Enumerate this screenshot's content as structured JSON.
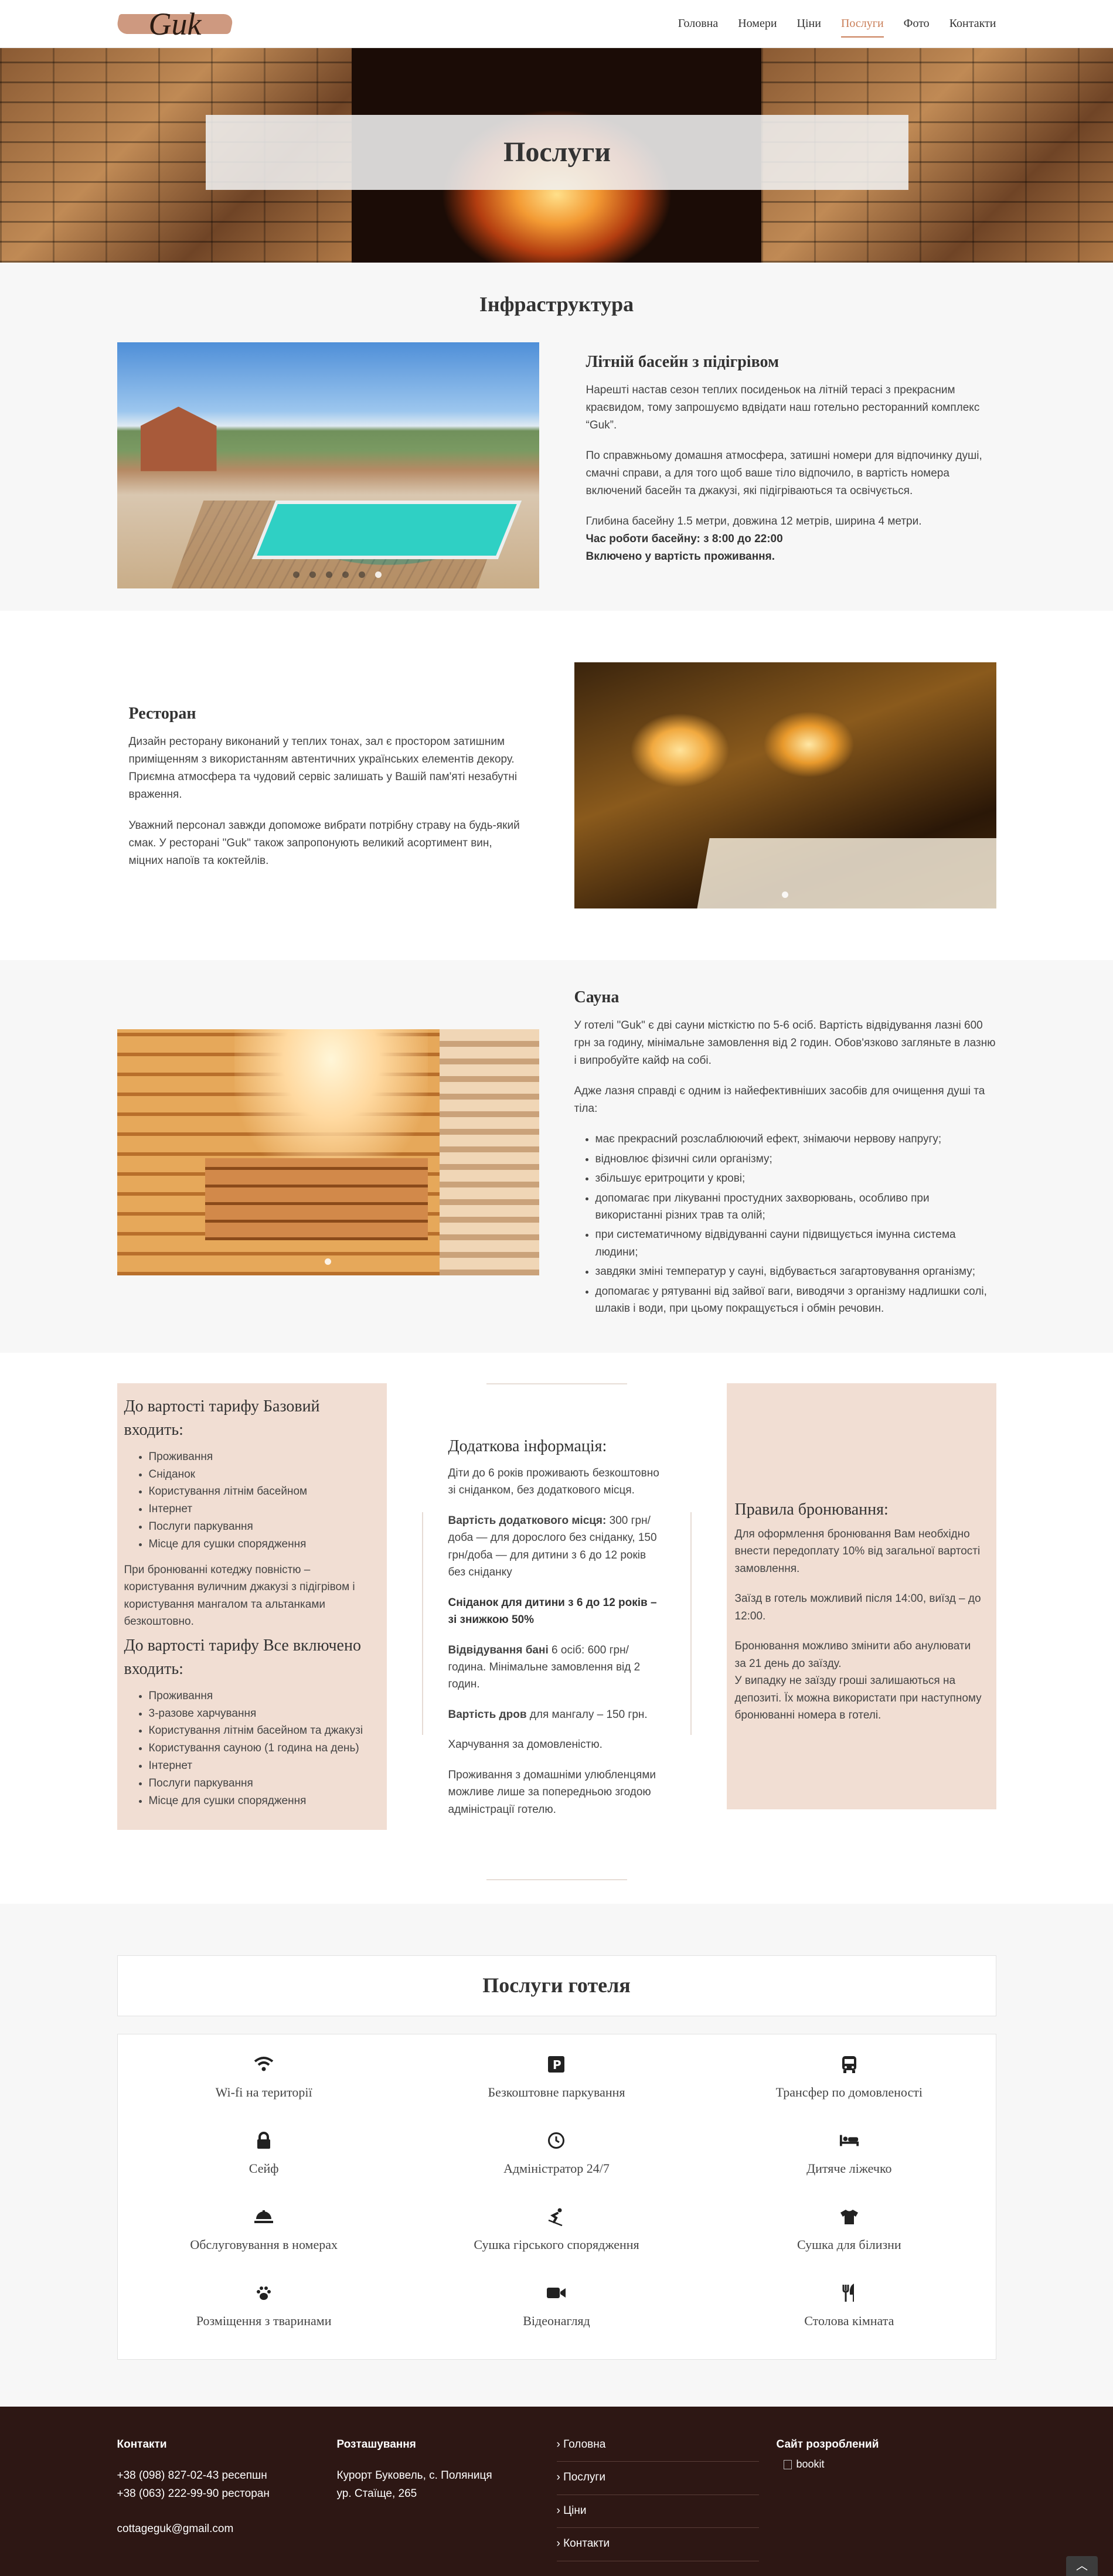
{
  "header": {
    "logo_text": "Guk",
    "nav": [
      {
        "label": "Головна"
      },
      {
        "label": "Номери"
      },
      {
        "label": "Ціни"
      },
      {
        "label": "Послуги",
        "active": true
      },
      {
        "label": "Фото"
      },
      {
        "label": "Контакти"
      }
    ],
    "accent_color": "#c97d57"
  },
  "hero": {
    "title": "Послуги"
  },
  "infrastructure": {
    "title": "Інфраструктура",
    "pool": {
      "title": "Літній басейн з підігрівом",
      "p1": "Нарешті настав сезон теплих посиденьок на літній терасі з прекрасним краєвидом, тому запрошуємо вдвідати наш готельно ресторанний комплекс “Guk”.",
      "p2": "По справжньому домашня атмосфера, затишні номери для відпочинку душі, смачні справи, а для того щоб ваше тіло відпочило, в вартість номера включений басейн та джакузі, які підігріваються та освічується.",
      "p3": "Глибина басейну 1.5 метри, довжина 12 метрів, ширина 4 метри.",
      "hours": "Час роботи басейну: з 8:00 до 22:00",
      "included": "Включено у вартість проживання.",
      "slides": 6
    },
    "restaurant": {
      "title": "Ресторан",
      "p1": "Дизайн ресторану виконаний у теплих тонах, зал є простором затишним приміщенням з використанням автентичних українських елементів декору.",
      "p2": "Приємна атмосфера та чудовий сервіс залишать у Вашій пам'яті незабутні враження.",
      "p3": "Уважний персонал завжди допоможе вибрати потрібну страву на будь-який смак. У ресторані \"Guk\" також запропонують великий асортимент вин, міцних напоїв та коктейлів.",
      "slides": 1
    },
    "sauna": {
      "title": "Сауна",
      "p1": "У готелі \"Guk\" є дві сауни місткістю по 5-6 осіб. Вартість відвідування лазні 600 грн за годину, мінімальне замовлення від 2 годин. Обов'язково загляньте в лазню і випробуйте кайф на собі.",
      "p2": "Адже лазня справді є одним із найефективніших засобів для очищення душі та тіла:",
      "benefits": [
        "має прекрасний розслаблюючий ефект, знімаючи нервову напругу;",
        "відновлює фізичні сили організму;",
        "збільшує еритроцити у крові;",
        "допомагає при лікуванні простудних захворювань, особливо при використанні різних трав та олій;",
        "при систематичному відвідуванні сауни підвищується імунна система людини;",
        "завдяки зміні температур у сауні, відбувається загартовування організму;",
        "допомагає у рятуванні від зайвої ваги, виводячи з організму надлишки солі, шлаків і води, при цьому покращується і обмін речовин."
      ],
      "slides": 1
    }
  },
  "tariffs": {
    "base": {
      "title": "До вартості тарифу Базовий входить:",
      "items": [
        "Проживання",
        "Сніданок",
        "Користування літнім басейном",
        "Інтернет",
        "Послуги паркування",
        "Місце для сушки спорядження"
      ],
      "note": "При бронюванні котеджу повністю – користування вуличним джакузі з підігрівом і користування мангалом та альтанками безкоштовно."
    },
    "all_inclusive": {
      "title": "До вартості тарифу Все включено входить:",
      "items": [
        "Проживання",
        "3-разове харчування",
        "Користування літнім басейном та джакузі",
        "Користування сауною (1 година на день)",
        "Інтернет",
        "Послуги паркування",
        "Місце для сушки спорядження"
      ]
    },
    "extra": {
      "title": "Додаткова інформація:",
      "p1": "Діти до 6 років проживають безкоштовно зі сніданком, без додаткового місця.",
      "extra_bed_label": "Вартість додаткового місця:",
      "extra_bed_text": " 300 грн/доба — для дорослого без сніданку, 150 грн/доба — для дитини з 6 до 12 років без сніданку",
      "kids_breakfast": "Сніданок для дитини з 6 до 12 років – зі знижкою 50%",
      "bath_label": "Відвідування бані",
      "bath_text": " 6 осіб: 600 грн/година. Мінімальне замовлення від 2 годин.",
      "wood_label": "Вартість дров",
      "wood_text": " для мангалу – 150 грн.",
      "meals": "Харчування за домовленістю.",
      "pets": "Проживання з домашніми улюбленцями можливе лише за попередньою згодою адміністрації готелю."
    },
    "rules": {
      "title": "Правила бронювання:",
      "p1": "Для оформлення бронювання Вам необхідно внести передоплату 10% від загальної вартості замовлення.",
      "p2": "Заїзд в готель можливий після 14:00, виїзд – до 12:00.",
      "p3": "Бронювання можливо змінити або анулювати за 21 день до заїзду.",
      "p4": "У випадку не заїзду гроші залишаються на депозиті. Їх можна використати при наступному бронюванні номера в готелі."
    }
  },
  "services": {
    "title": "Послуги готеля",
    "items": [
      {
        "label": "Wi-fi на території",
        "icon": "wifi-icon",
        "glyph": "📶"
      },
      {
        "label": "Безкоштовне паркування",
        "icon": "parking-icon",
        "glyph": "P"
      },
      {
        "label": "Трансфер по домовленості",
        "icon": "bus-icon",
        "glyph": "🚍"
      },
      {
        "label": "Сейф",
        "icon": "lock-icon",
        "glyph": "🔒"
      },
      {
        "label": "Адміністратор 24/7",
        "icon": "clock-icon",
        "glyph": "🕓"
      },
      {
        "label": "Дитяче ліжечко",
        "icon": "bed-icon",
        "glyph": "🛏"
      },
      {
        "label": "Обслуговування в номерах",
        "icon": "room-service-icon",
        "glyph": "⏏"
      },
      {
        "label": "Сушка гірського спорядження",
        "icon": "skier-icon",
        "glyph": "⛷"
      },
      {
        "label": "Сушка для білизни",
        "icon": "tshirt-icon",
        "glyph": "👕"
      },
      {
        "label": "Розміщення з тваринами",
        "icon": "paw-icon",
        "glyph": "🐾"
      },
      {
        "label": "Відеонагляд",
        "icon": "video-camera-icon",
        "glyph": "📹"
      },
      {
        "label": "Столова кімната",
        "icon": "utensils-icon",
        "glyph": "🍴"
      }
    ]
  },
  "footer": {
    "contacts": {
      "title": "Контакти",
      "phone1": "+38 (098) 827-02-43 ресепшн",
      "phone2": "+38 (063) 222-99-90 ресторан",
      "email": "cottageguk@gmail.com"
    },
    "location": {
      "title": "Розташування",
      "line1": "Курорт Буковель, с. Поляниця",
      "line2": "ур. Стаїще, 265"
    },
    "menu": [
      "Головна",
      "Послуги",
      "Ціни",
      "Контакти"
    ],
    "dev": {
      "title": "Сайт розроблений",
      "img_alt": "bookit"
    },
    "footer_bg": "#2d1714"
  }
}
